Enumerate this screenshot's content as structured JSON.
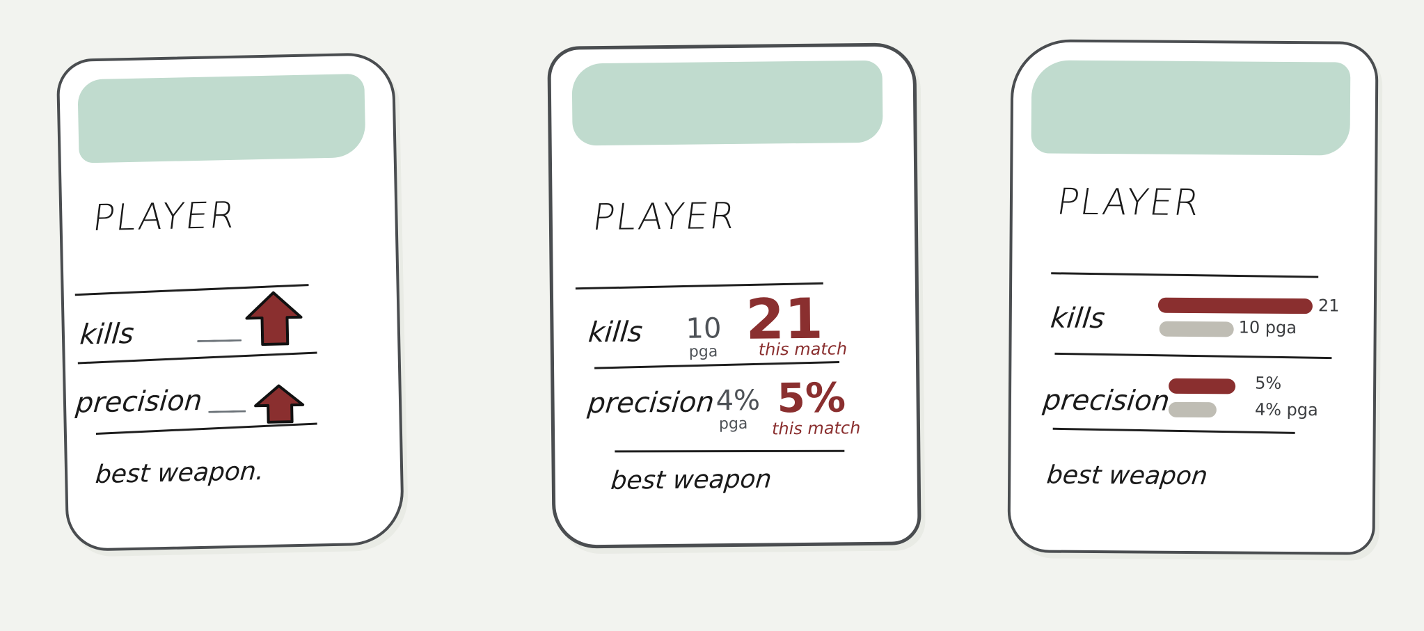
{
  "cards": [
    {
      "title": "PLAYER",
      "kills_label": "kills",
      "precision_label": "precision",
      "best_weapon_label": "best weapon.",
      "arrow_icon": "up-arrow-icon"
    },
    {
      "title": "PLAYER",
      "kills_label": "kills",
      "kills_avg": "10",
      "kills_avg_note": "pga",
      "kills_match": "21",
      "kills_match_note": "this match",
      "precision_label": "precision",
      "precision_avg": "4%",
      "precision_avg_note": "pga",
      "precision_match": "5%",
      "precision_match_note": "this match",
      "best_weapon_label": "best weapon"
    },
    {
      "title": "PLAYER",
      "kills_label": "kills",
      "kills_match": "21",
      "kills_avg": "10 pga",
      "precision_label": "precision",
      "precision_match": "5%",
      "precision_avg": "4% pga",
      "best_weapon_label": "best weapon",
      "bars": {
        "kills_match_fraction": 1.0,
        "kills_avg_fraction": 0.48,
        "precision_match_fraction": 1.0,
        "precision_avg_fraction": 0.72
      }
    }
  ],
  "colors": {
    "background": "#f2f3ef",
    "card": "#ffffff",
    "header_band": "#c0dbce",
    "accent_red": "#8a2f2f",
    "muted_grey": "#bfbdb4",
    "ink": "#1a1a1a"
  }
}
